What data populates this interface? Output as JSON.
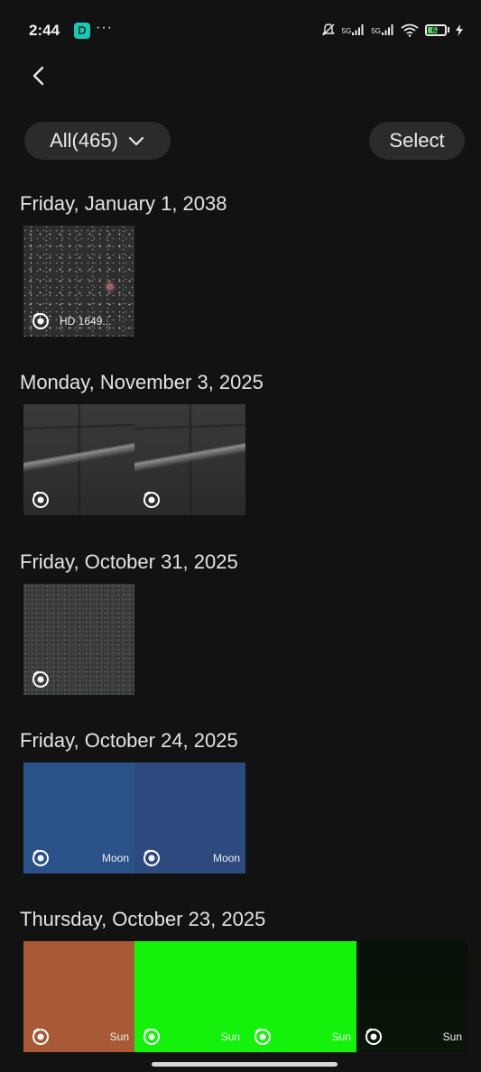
{
  "status_bar": {
    "time": "2:44",
    "app_badge": "D",
    "more": "···",
    "signal1_label": "5G",
    "signal2_label": "5G",
    "battery": "62",
    "battery_level": 0.62
  },
  "header": {
    "filter_label": "All(465)",
    "select_label": "Select"
  },
  "sections": [
    {
      "date": "Friday, January 1, 2038",
      "thumbs": [
        {
          "caption": "HD 1649...",
          "texture": "stars"
        }
      ]
    },
    {
      "date": "Monday, November 3, 2025",
      "thumbs": [
        {
          "caption": "",
          "texture": "ceiling"
        },
        {
          "caption": "",
          "texture": "ceiling"
        }
      ]
    },
    {
      "date": "Friday, October 31, 2025",
      "thumbs": [
        {
          "caption": "",
          "texture": "noise"
        }
      ]
    },
    {
      "date": "Friday, October 24, 2025",
      "thumbs": [
        {
          "caption": "Moon",
          "texture": "blue1"
        },
        {
          "caption": "Moon",
          "texture": "blue2"
        }
      ]
    },
    {
      "date": "Thursday, October 23, 2025",
      "thumbs": [
        {
          "caption": "Sun",
          "texture": "orange"
        },
        {
          "caption": "Sun",
          "texture": "green"
        },
        {
          "caption": "Sun",
          "texture": "green"
        },
        {
          "caption": "Sun",
          "texture": "dark"
        }
      ]
    }
  ],
  "colors": {
    "background": "#121212",
    "pill": "#2b2b2b",
    "text": "#e9e9e9"
  },
  "icons": {
    "back": "chevron-left-icon",
    "dropdown": "chevron-down-icon",
    "thumb_badge": "telescope-target-icon",
    "mute": "bell-off-icon",
    "wifi": "wifi-icon"
  }
}
